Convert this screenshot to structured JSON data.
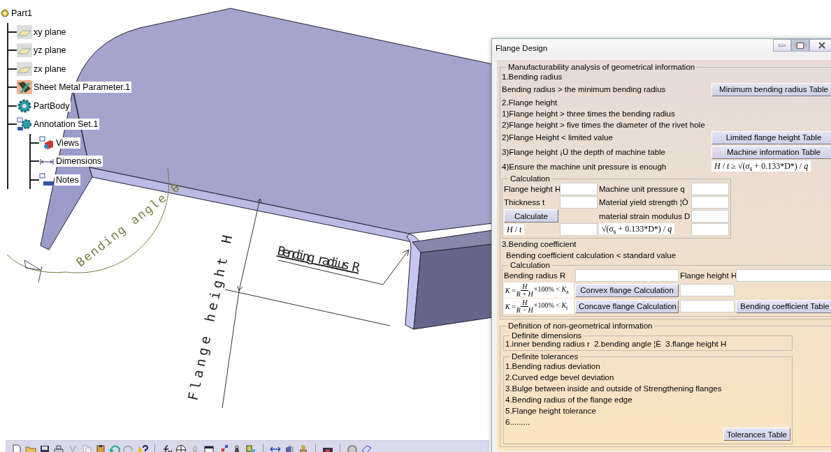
{
  "tree": {
    "label": "Part1",
    "kind": "part",
    "children": [
      {
        "label": "xy plane",
        "kind": "plane"
      },
      {
        "label": "yz plane",
        "kind": "plane"
      },
      {
        "label": "zx plane",
        "kind": "plane"
      },
      {
        "label": "Sheet Metal Parameter.1",
        "kind": "parameters"
      },
      {
        "label": "PartBody",
        "kind": "body"
      },
      {
        "label": "Annotation Set.1",
        "kind": "annotation",
        "children": [
          {
            "label": "Views",
            "kind": "views"
          },
          {
            "label": "Dimensions",
            "kind": "dimensions"
          },
          {
            "label": "Notes",
            "kind": "notes"
          }
        ]
      }
    ]
  },
  "annotations": [
    {
      "kind": "angle",
      "text": "Bending angle θ"
    },
    {
      "kind": "radius",
      "text": "Bending radius R"
    },
    {
      "kind": "height",
      "text": "Flange height H"
    }
  ],
  "dialog": {
    "title": "Flange Design",
    "geometric": {
      "legend": "Manufacturability analysis of geometrical information",
      "rows": [
        {
          "text": "1.Bending radius"
        },
        {
          "text": "Bending radius > the minimum bending radius",
          "button": "Minimum bending radius Table"
        },
        {
          "text": "2.Flange height"
        },
        {
          "text": "1)Flange height > three times the bending radius"
        },
        {
          "text": "2)Flange height > five times the diameter of the rivet hole"
        },
        {
          "text": "2)Flange Height < limited value",
          "button": "Limited flange height Table"
        },
        {
          "text": "3)Flange height ¡Ü the depth of machine table",
          "button": "Machine information Table"
        },
        {
          "text": "4)Ensure the machine unit pressure is enough",
          "formula": "*H* / *t* ≥ √(*σ*$_{s}$ + 0.133*D*) / *q*"
        }
      ],
      "calc": {
        "legend": "Calculation",
        "cells": [
          {
            "kind": "label",
            "text": "Flange height H"
          },
          {
            "kind": "input"
          },
          {
            "kind": "label",
            "text": "Machine unit pressure q"
          },
          {
            "kind": "input"
          },
          {
            "kind": "label",
            "text": "Thickness t"
          },
          {
            "kind": "input"
          },
          {
            "kind": "label",
            "text": "Material yield strength ¦Ò"
          },
          {
            "kind": "input"
          },
          {
            "kind": "button",
            "text": "Calculate"
          },
          {
            "kind": "empty"
          },
          {
            "kind": "label",
            "text": "material strain modulus D"
          },
          {
            "kind": "input"
          },
          {
            "kind": "formula",
            "text": "*H* / *t*"
          },
          {
            "kind": "input"
          },
          {
            "kind": "formula",
            "text": "√(*σ*$_{s}$ + 0.133*D*) / *q*"
          },
          {
            "kind": "input"
          }
        ]
      }
    },
    "bending": {
      "heading": "3.Bending coefficient",
      "text": "Bending coefficient calculation < standard value",
      "calc": {
        "legend": "Calculation",
        "cells": [
          {
            "kind": "label",
            "text": "Bending radius R"
          },
          {
            "kind": "input"
          },
          {
            "kind": "label",
            "text": "Flange height H"
          },
          {
            "kind": "input"
          },
          {
            "kind": "fraction",
            "lhs": "*K* =",
            "num": "*H*",
            "den": "*R* + *H*",
            "rhs": "×100% < *K*$_{a}$"
          },
          {
            "kind": "button",
            "text": "Convex flange Calculation"
          },
          {
            "kind": "input"
          },
          {
            "kind": "empty"
          },
          {
            "kind": "fraction",
            "lhs": "*K* =",
            "num": "*H*",
            "den": "*R* − *H*",
            "rhs": "×100% < *K*$_{t}$"
          },
          {
            "kind": "button",
            "text": "Concave flange Calculation"
          },
          {
            "kind": "input"
          },
          {
            "kind": "button",
            "text": "Bending coefficient Table"
          }
        ]
      }
    },
    "definition": {
      "legend": "Definition of non-geometrical information",
      "dimensions": {
        "legend": "Definite dimensions",
        "text": "1.inner bending radius r  2.bending angle ¦È  3.flange height H"
      },
      "tolerances": {
        "legend": "Definite tolerances",
        "lines": [
          "1.Bending radius deviation",
          "2.Curved edge bevel deviation",
          "3.Bulge between inside and outside of Strengthening flanges",
          "4.Bending radius of the flange edge",
          "5.Flange height tolerance",
          "6........."
        ],
        "button": "Tolerances Table"
      }
    }
  }
}
